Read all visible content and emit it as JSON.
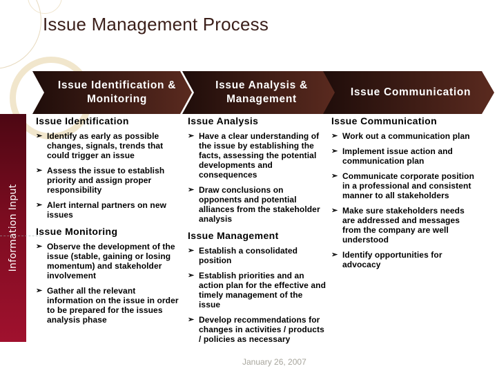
{
  "slide": {
    "title": "Issue Management Process",
    "date": "January 26, 2007"
  },
  "colors": {
    "banner_dark": "#2c1410",
    "banner_light": "#5a2a1f",
    "sidebar_top": "#4d0713",
    "sidebar_bottom": "#a0112e",
    "title_text": "#3b1f1a",
    "date_text": "#a7a59c"
  },
  "sidebar": {
    "label": "Information Input"
  },
  "banners": [
    {
      "label": "Issue Identification & Monitoring"
    },
    {
      "label": "Issue Analysis & Management"
    },
    {
      "label": "Issue Communication"
    }
  ],
  "bullet_icon": "arrow-bullet-icon",
  "columns": [
    {
      "sections": [
        {
          "heading": "Issue Identification",
          "items": [
            "Identify as early as possible changes, signals, trends that could trigger an issue",
            "Assess the issue to establish priority and assign proper responsibility",
            "Alert internal partners on new issues"
          ]
        },
        {
          "heading": "Issue Monitoring",
          "items": [
            "Observe the development of the issue (stable, gaining or losing momentum) and stakeholder involvement",
            "Gather all the relevant information on the issue in order to be prepared for the issues analysis phase"
          ]
        }
      ]
    },
    {
      "sections": [
        {
          "heading": "Issue Analysis",
          "items": [
            "Have a clear understanding of the issue by establishing the facts, assessing the potential developments and consequences",
            "Draw conclusions on opponents and potential alliances from the stakeholder analysis"
          ]
        },
        {
          "heading": "Issue Management",
          "items": [
            "Establish a consolidated position",
            "Establish priorities and an action plan for the effective and timely management of the issue",
            "Develop recommendations for changes in activities / products / policies as necessary"
          ]
        }
      ]
    },
    {
      "sections": [
        {
          "heading": "Issue Communication",
          "items": [
            "Work out a communication plan",
            "Implement issue action and communication plan",
            "Communicate corporate position in a professional and consistent manner to all stakeholders",
            "Make sure stakeholders needs are addressed and messages from the company are well understood",
            "Identify opportunities for advocacy"
          ]
        }
      ]
    }
  ]
}
